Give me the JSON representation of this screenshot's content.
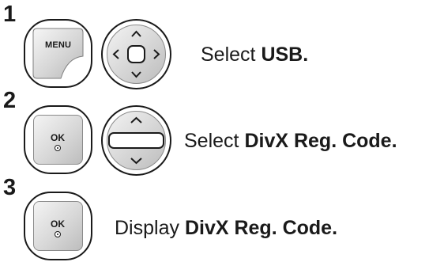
{
  "steps": [
    {
      "number": "1",
      "buttons": [
        "menu-button",
        "navigation-pad"
      ],
      "menu_label": "MENU",
      "verb": "Select",
      "target": "USB."
    },
    {
      "number": "2",
      "buttons": [
        "ok-button",
        "up-down-pad"
      ],
      "ok_label": "OK",
      "verb": "Select",
      "target": "DivX Reg. Code."
    },
    {
      "number": "3",
      "buttons": [
        "ok-button"
      ],
      "ok_label": "OK",
      "verb": "Display",
      "target": "DivX Reg. Code."
    }
  ]
}
